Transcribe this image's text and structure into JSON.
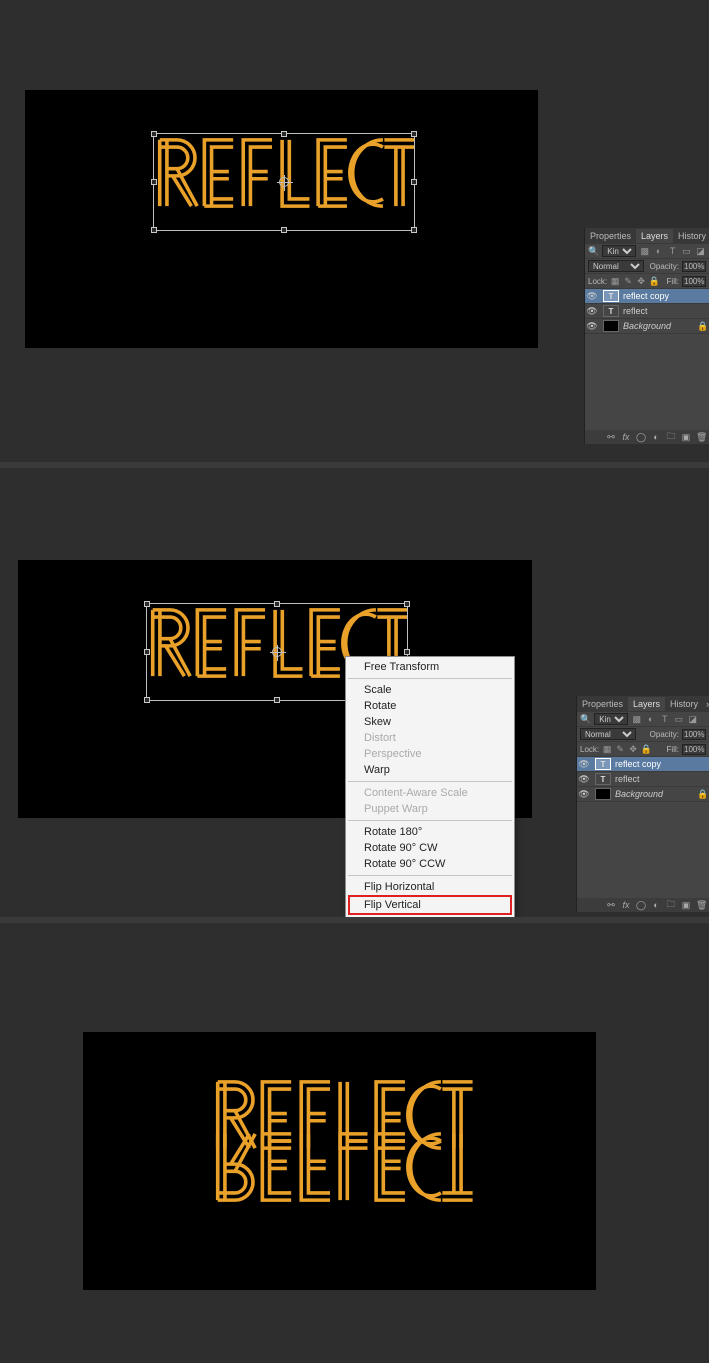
{
  "document_text": "REFLECT",
  "text_color": "#e9a12a",
  "panel": {
    "tabs": {
      "properties": "Properties",
      "layers": "Layers",
      "history": "History"
    },
    "filter_kind": "Kind",
    "blend_mode": "Normal",
    "opacity_label": "Opacity:",
    "opacity_value": "100%",
    "lock_label": "Lock:",
    "fill_label": "Fill:",
    "fill_value": "100%",
    "layers": {
      "0": {
        "name": "reflect copy",
        "type": "T"
      },
      "1": {
        "name": "reflect",
        "type": "T"
      },
      "2": {
        "name": "Background",
        "type": "bg"
      }
    }
  },
  "context_menu": {
    "free_transform": "Free Transform",
    "scale": "Scale",
    "rotate": "Rotate",
    "skew": "Skew",
    "distort": "Distort",
    "perspective": "Perspective",
    "warp": "Warp",
    "content_aware_scale": "Content-Aware Scale",
    "puppet_warp": "Puppet Warp",
    "rotate_180": "Rotate 180°",
    "rotate_90_cw": "Rotate 90° CW",
    "rotate_90_ccw": "Rotate 90° CCW",
    "flip_horizontal": "Flip Horizontal",
    "flip_vertical": "Flip Vertical"
  }
}
